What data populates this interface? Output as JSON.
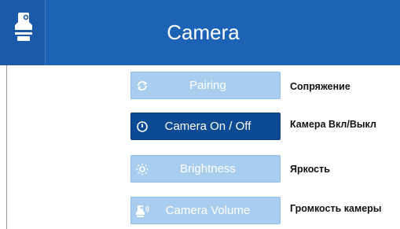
{
  "header": {
    "title": "Camera",
    "icon": "camera-device-icon"
  },
  "menu": [
    {
      "label": "Pairing",
      "icon": "refresh-icon",
      "state": "normal",
      "caption": "Сопряжение"
    },
    {
      "label": "Camera On / Off",
      "icon": "power-icon",
      "state": "selected",
      "caption": "Камера Вкл/Выкл"
    },
    {
      "label": "Brightness",
      "icon": "brightness-icon",
      "state": "normal",
      "caption": "Яркость"
    },
    {
      "label": "Camera Volume",
      "icon": "camera-volume-icon",
      "state": "normal",
      "caption": "Громкость камеры"
    }
  ],
  "colors": {
    "header": "#1d63b5",
    "button_normal": "#a8cdee",
    "button_selected": "#0d4a94"
  }
}
